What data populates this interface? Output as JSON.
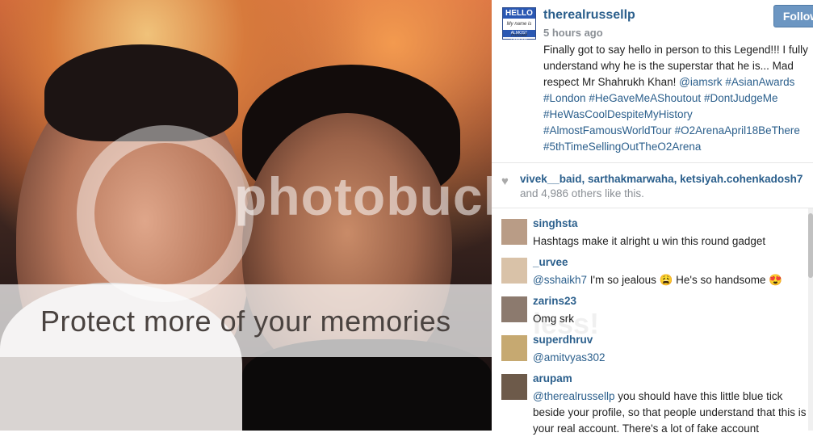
{
  "photo": {
    "watermark_brand": "photobucket",
    "watermark_message": "Protect more of your memories",
    "watermark_faint": "less!"
  },
  "post": {
    "logo": {
      "top": "HELLO",
      "middle": "My name is Russell",
      "bottom": "ALMOST FAMOUS"
    },
    "username": "therealrussellp",
    "time": "5 hours ago",
    "follow_label": "Follow",
    "caption_text": "Finally got to say hello in person to this Legend!!! I fully understand why he is the superstar that he is... Mad respect Mr Shahrukh Khan!",
    "caption_tags": [
      "@iamsrk",
      "#AsianAwards",
      "#London",
      "#HeGaveMeAShoutout",
      "#DontJudgeMe",
      "#HeWasCoolDespiteMyHistory",
      "#AlmostFamousWorldTour",
      "#O2ArenaApril18BeThere",
      "#5thTimeSellingOutTheO2Arena"
    ]
  },
  "likes": {
    "likers": "vivek__baid, sarthakmarwaha, ketsiyah.cohenkadosh7",
    "count_text": "and 4,986 others like this."
  },
  "comments": [
    {
      "user": "singhsta",
      "text": "Hashtags make it alright u win this round gadget",
      "mention": ""
    },
    {
      "user": "_urvee",
      "mention": "@sshaikh7",
      "text": " I'm so jealous 😩 He's so handsome 😍"
    },
    {
      "user": "zarins23",
      "text": "Omg srk",
      "mention": ""
    },
    {
      "user": "superdhruv",
      "mention": "@amitvyas302",
      "text": ""
    },
    {
      "user": "arupam",
      "mention": "@therealrussellp",
      "text": " you should have this little blue tick beside your profile, so that people understand that this is your real account. There's a lot of fake account"
    }
  ],
  "colors": {
    "link": "#2b5f8c",
    "follow_bg": "#6c96c2",
    "muted": "#8a8f95"
  }
}
